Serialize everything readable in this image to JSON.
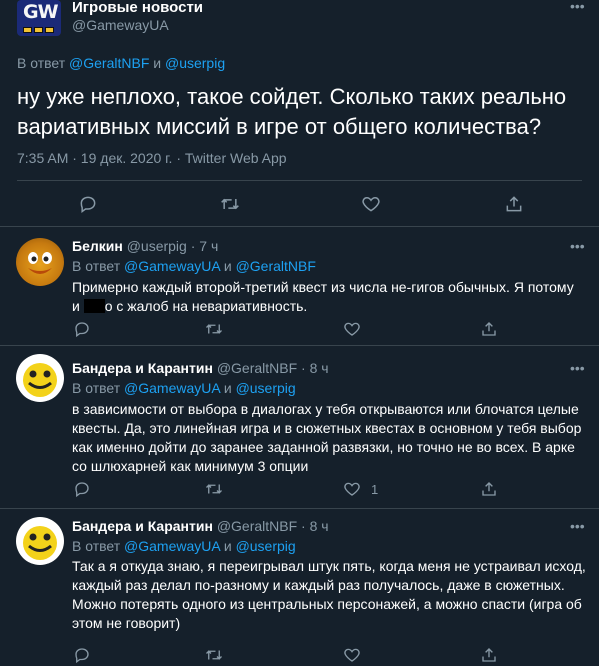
{
  "main_tweet": {
    "author_name": "Игровые новости",
    "author_handle": "@GamewayUA",
    "avatar_logo_text": "GW",
    "reply_label": "В ответ",
    "reply_user_1": "@GeraltNBF",
    "reply_joiner": "и",
    "reply_user_2": "@userpig",
    "text": "ну уже неплохо, такое сойдет. Сколько таких реально вариативных миссий в игре от общего количества?",
    "timestamp": "7:35 AM · 19 дек. 2020 г. · Twitter Web App",
    "more_glyph": "•••"
  },
  "replies": [
    {
      "author_name": "Белкин",
      "author_handle": "@userpig",
      "time": "7 ч",
      "reply_label": "В ответ",
      "reply_user_1": "@GamewayUA",
      "reply_joiner": "и",
      "reply_user_2": "@GeraltNBF",
      "text_line1": "Примерно каждый второй-третий квест из числа не-гигов обычных. Я потому",
      "text_line2_pre": "и",
      "text_line2_post": "о с жалоб на невариативность.",
      "likes": "",
      "more_glyph": "•••"
    },
    {
      "author_name": "Бандера и Карантин",
      "author_handle": "@GeraltNBF",
      "time": "8 ч",
      "reply_label": "В ответ",
      "reply_user_1": "@GamewayUA",
      "reply_joiner": "и",
      "reply_user_2": "@userpig",
      "text": "в зависимости от выбора в диалогах у тебя открываются или блочатся целые квесты. Да, это линейная игра и в сюжетных квестах в основном у тебя выбор как именно дойти до заранее заданной развязки, но точно не во всех. В арке со шлюхарней как минимум 3 опции",
      "likes": "1",
      "more_glyph": "•••"
    },
    {
      "author_name": "Бандера и Карантин",
      "author_handle": "@GeraltNBF",
      "time": "8 ч",
      "reply_label": "В ответ",
      "reply_user_1": "@GamewayUA",
      "reply_joiner": "и",
      "reply_user_2": "@userpig",
      "text": "Так а я откуда знаю, я переигрывал штук пять, когда меня не устраивал исход, каждый раз делал по-разному и каждый раз получалось, даже в сюжетных. Можно потерять одного из центральных персонажей, а можно спасти (игра об этом не говорит)",
      "likes": "",
      "more_glyph": "•••"
    }
  ],
  "colors": {
    "background": "#15202b",
    "text_primary": "#ffffff",
    "text_secondary": "#8899a6",
    "link": "#1da1f2",
    "divider": "#38444d"
  }
}
